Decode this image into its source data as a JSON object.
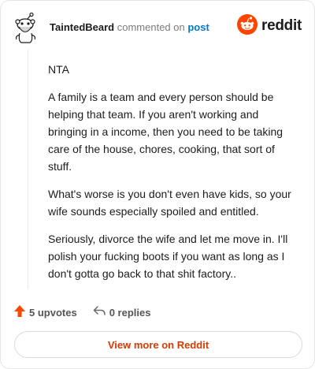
{
  "header": {
    "username": "TaintedBeard",
    "action": "commented on",
    "target": "post",
    "avatar_icon": "snoo-avatar-icon",
    "brand_icon": "reddit-snoo-icon",
    "brand_word": "reddit"
  },
  "comment": {
    "paragraphs": [
      "NTA",
      "A family is a team and every person should be helping that team. If you aren't working and bringing in a income, then you need to be taking care of the house, chores, cooking, that sort of stuff.",
      "What's worse is you don't even have kids, so your wife sounds especially spoiled and entitled.",
      "Seriously, divorce the wife and let me move in. I'll polish your fucking boots if you want as long as I don't gotta go back to that shit factory.."
    ]
  },
  "footer": {
    "upvotes": "5 upvotes",
    "upvote_icon": "upvote-arrow-icon",
    "replies": "0 replies",
    "reply_icon": "reply-arrow-icon"
  },
  "view_more": "View more on Reddit",
  "colors": {
    "brand": "#ff4500",
    "link": "#0079d3",
    "button_text": "#d93a00"
  }
}
